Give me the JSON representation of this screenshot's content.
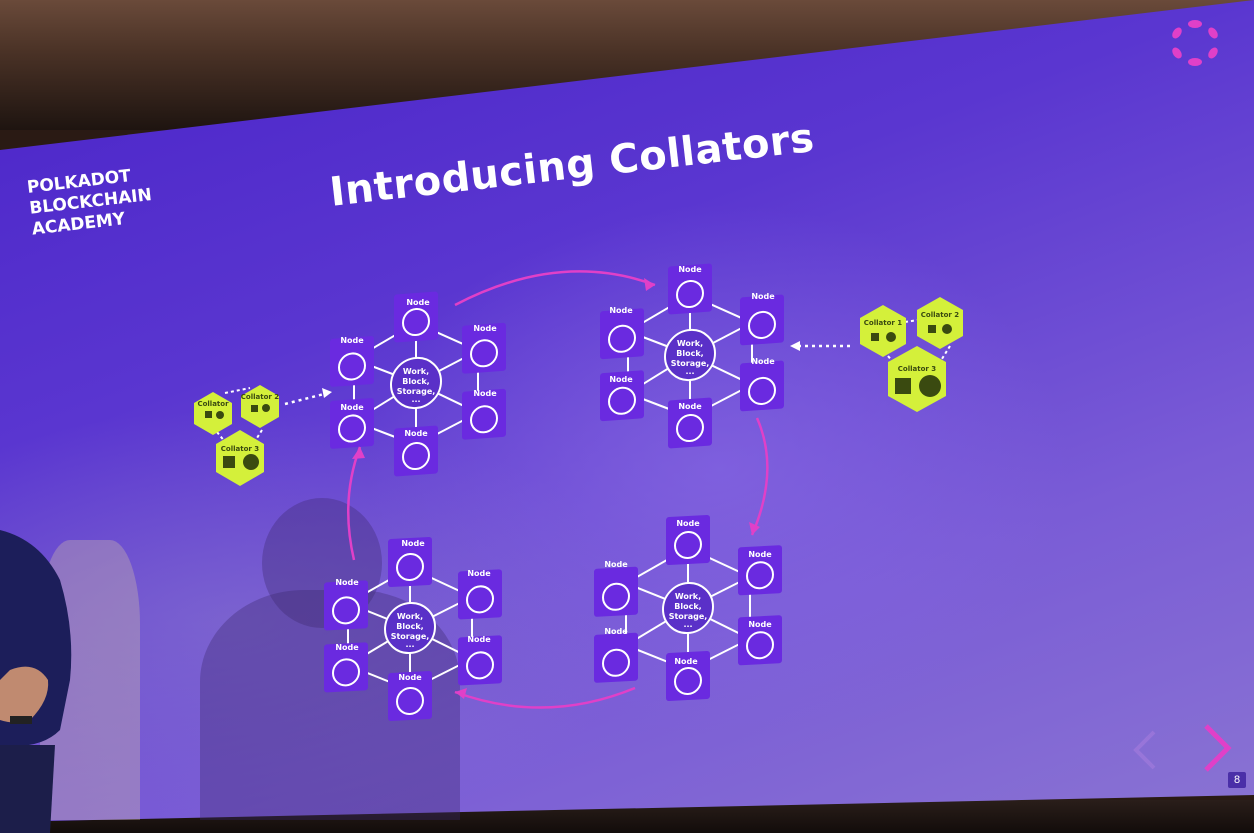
{
  "slide": {
    "brand_lines": [
      "POLKADOT",
      "BLOCKCHAIN",
      "ACADEMY"
    ],
    "title": "Introducing Collators",
    "page_number": "8"
  },
  "diagram": {
    "node_label": "Node",
    "node_inner_label": "Work, Block",
    "hub_lines": [
      "Work,",
      "Block,",
      "Storage,",
      "..."
    ],
    "clusters": 4,
    "collator_groups": [
      {
        "position": "left",
        "collators": [
          "Collator",
          "Collator 2",
          "Collator 3"
        ]
      },
      {
        "position": "right",
        "collators": [
          "Collator 1",
          "Collator 2",
          "Collator 3"
        ]
      }
    ]
  },
  "colors": {
    "slide_background": "#5a36d0",
    "node_fill": "#6a2ae0",
    "collator_fill": "#d4f03a",
    "accent_pink": "#e040c8"
  }
}
